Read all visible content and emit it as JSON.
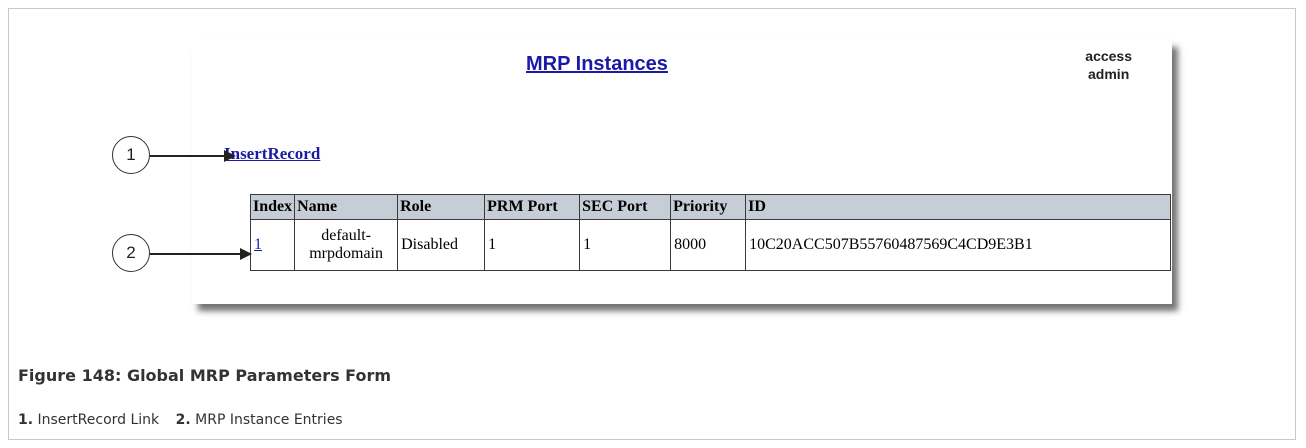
{
  "screenshot": {
    "title": "MRP Instances",
    "access_label": "access",
    "access_user": "admin",
    "insert_link": "InsertRecord",
    "table": {
      "headers": [
        "Index",
        "Name",
        "Role",
        "PRM Port",
        "SEC Port",
        "Priority",
        "ID"
      ],
      "rows": [
        {
          "index": "1",
          "name_line1": "default-",
          "name_line2": "mrpdomain",
          "role": "Disabled",
          "prm_port": "1",
          "sec_port": "1",
          "priority": "8000",
          "id": "10C20ACC507B55760487569C4CD9E3B1"
        }
      ]
    }
  },
  "callouts": [
    {
      "number": "1"
    },
    {
      "number": "2"
    }
  ],
  "caption": "Figure 148: Global MRP Parameters Form",
  "legend": [
    {
      "number": "1.",
      "text": "InsertRecord Link"
    },
    {
      "number": "2.",
      "text": "MRP Instance Entries"
    }
  ],
  "colors": {
    "link": "#1a1aa6",
    "header_bg": "#c6cdd6"
  }
}
